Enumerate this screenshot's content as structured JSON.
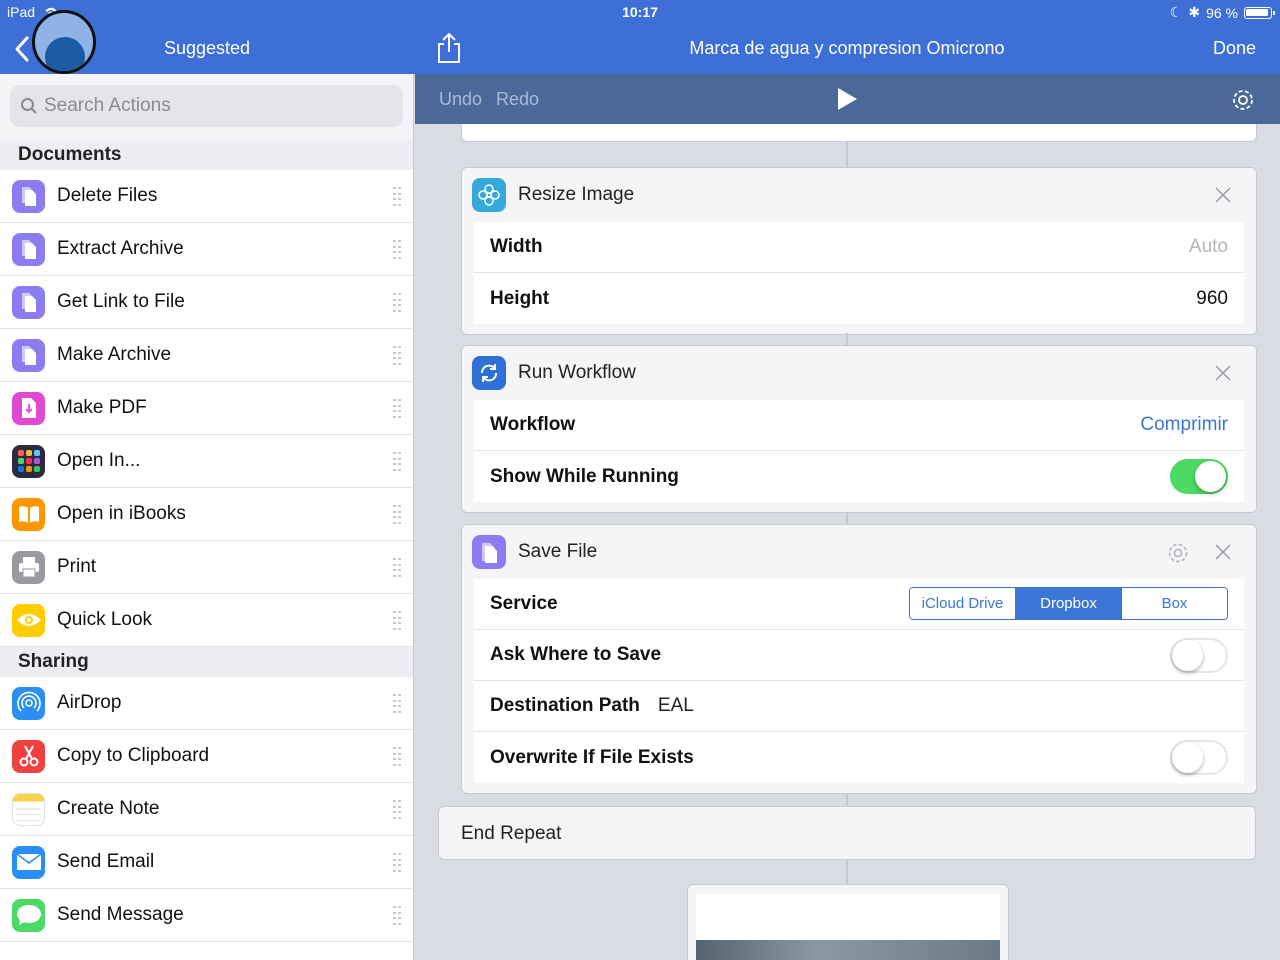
{
  "status": {
    "device": "iPad",
    "time": "10:17",
    "battery": "96 %"
  },
  "sidebar": {
    "title": "Suggested",
    "search_placeholder": "Search Actions",
    "sections": [
      {
        "header": "Documents",
        "items": [
          {
            "label": "Delete Files",
            "icon": "document-icon",
            "color": "#8b7cf2"
          },
          {
            "label": "Extract Archive",
            "icon": "document-icon",
            "color": "#8b7cf2"
          },
          {
            "label": "Get Link to File",
            "icon": "document-icon",
            "color": "#8b7cf2"
          },
          {
            "label": "Make Archive",
            "icon": "document-icon",
            "color": "#8b7cf2"
          },
          {
            "label": "Make PDF",
            "icon": "pdf-icon",
            "color": "#e04ad0"
          },
          {
            "label": "Open In...",
            "icon": "app-grid-icon",
            "color": "#2c2c40"
          },
          {
            "label": "Open in iBooks",
            "icon": "book-icon",
            "color": "#ff9500"
          },
          {
            "label": "Print",
            "icon": "printer-icon",
            "color": "#9a9aa0"
          },
          {
            "label": "Quick Look",
            "icon": "eye-icon",
            "color": "#ffcc00"
          }
        ]
      },
      {
        "header": "Sharing",
        "items": [
          {
            "label": "AirDrop",
            "icon": "airdrop-icon",
            "color": "#2a8ef2"
          },
          {
            "label": "Copy to Clipboard",
            "icon": "scissors-icon",
            "color": "#f04040"
          },
          {
            "label": "Create Note",
            "icon": "note-icon",
            "color": "#f8d248"
          },
          {
            "label": "Send Email",
            "icon": "mail-icon",
            "color": "#2a8ef2"
          },
          {
            "label": "Send Message",
            "icon": "message-icon",
            "color": "#4cd964"
          }
        ]
      }
    ]
  },
  "header": {
    "title": "Marca de agua y compresion Omicrono",
    "done_label": "Done"
  },
  "toolbar": {
    "undo_label": "Undo",
    "redo_label": "Redo"
  },
  "workflow": {
    "resize": {
      "title": "Resize Image",
      "width_label": "Width",
      "width_value": "Auto",
      "height_label": "Height",
      "height_value": "960"
    },
    "run": {
      "title": "Run Workflow",
      "workflow_label": "Workflow",
      "workflow_value": "Comprimir",
      "show_label": "Show While Running",
      "show_value": true
    },
    "save": {
      "title": "Save File",
      "service_label": "Service",
      "services": [
        "iCloud Drive",
        "Dropbox",
        "Box"
      ],
      "selected_service": "Dropbox",
      "ask_label": "Ask Where to Save",
      "ask_value": false,
      "path_label": "Destination Path",
      "path_value": "EAL",
      "overwrite_label": "Overwrite If File Exists",
      "overwrite_value": false
    },
    "end_repeat_label": "End Repeat"
  },
  "colors": {
    "accent": "#3d6fd6",
    "toolbar": "#4a6898",
    "switch_on": "#4cd964",
    "link": "#3b76d6"
  }
}
